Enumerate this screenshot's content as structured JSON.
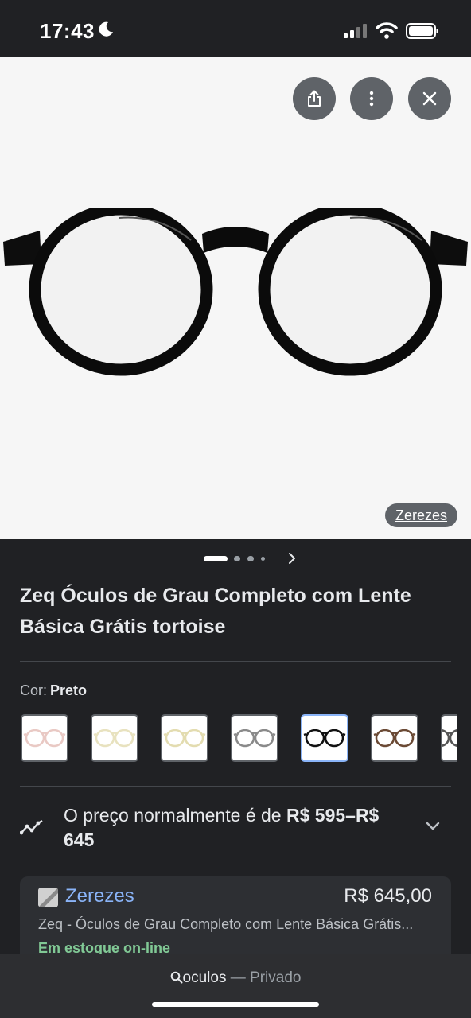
{
  "status_bar": {
    "time": "17:43",
    "icons": [
      "moon-icon",
      "signal-icon",
      "wifi-icon",
      "battery-icon"
    ]
  },
  "viewer": {
    "actions": [
      "share-icon",
      "more-vert-icon",
      "close-icon"
    ],
    "image_source": "Zerezes",
    "carousel": {
      "total": 4,
      "active_index": 0
    }
  },
  "product": {
    "title": "Zeq Óculos de Grau Completo com Lente Básica Grátis tortoise"
  },
  "color": {
    "label": "Cor:",
    "value": "Preto",
    "swatches": [
      {
        "name": "pink-clear",
        "selected": false,
        "frame_color": "#e9c9c4"
      },
      {
        "name": "cream-clear",
        "selected": false,
        "frame_color": "#e8e2bf"
      },
      {
        "name": "beige-clear",
        "selected": false,
        "frame_color": "#e3dcb0"
      },
      {
        "name": "grey",
        "selected": false,
        "frame_color": "#8a8a8a"
      },
      {
        "name": "black",
        "selected": true,
        "frame_color": "#111111"
      },
      {
        "name": "tortoise",
        "selected": false,
        "frame_color": "#6b4a35"
      },
      {
        "name": "partial",
        "selected": false,
        "frame_color": "#555555"
      }
    ]
  },
  "price_history": {
    "prefix": "O preço normalmente é de",
    "range": "R$ 595–R$ 645"
  },
  "offer": {
    "store": "Zerezes",
    "price": "R$ 645,00",
    "description": "Zeq - Óculos de Grau Completo com Lente Básica Grátis...",
    "stock": "Em estoque on-line"
  },
  "bottom_bar": {
    "query": "oculos",
    "separator": "—",
    "mode": "Privado"
  },
  "colors": {
    "background": "#202124",
    "link": "#8ab4f8",
    "in_stock": "#81c995"
  }
}
